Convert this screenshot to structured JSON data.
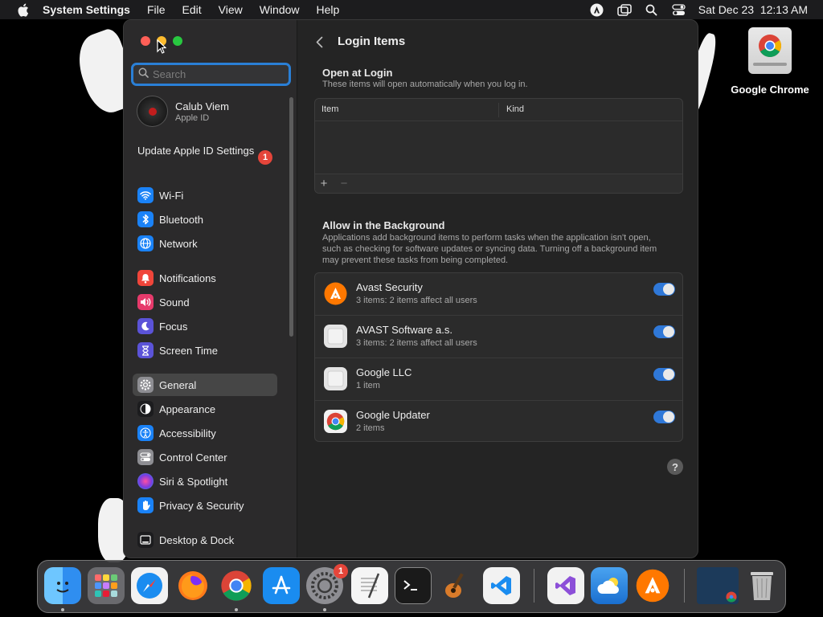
{
  "menubar": {
    "app_name": "System Settings",
    "menus": [
      "File",
      "Edit",
      "View",
      "Window",
      "Help"
    ],
    "datetime": "Sat Dec 23  12:13 AM",
    "status_icons": [
      "avast-icon",
      "window-icon",
      "search-icon",
      "control-center-icon"
    ]
  },
  "desktop": {
    "icon_label": "Google Chrome"
  },
  "sidebar": {
    "search_placeholder": "Search",
    "account_name": "Calub Viem",
    "account_sub": "Apple ID",
    "update_label": "Update Apple ID Settings",
    "update_badge": "1",
    "items": [
      {
        "label": "Wi-Fi",
        "icon": "wifi-icon",
        "color": "#1a82f7"
      },
      {
        "label": "Bluetooth",
        "icon": "bluetooth-icon",
        "color": "#1a82f7"
      },
      {
        "label": "Network",
        "icon": "globe-icon",
        "color": "#1a82f7"
      },
      {
        "label": "Notifications",
        "icon": "bell-icon",
        "color": "#f0453a"
      },
      {
        "label": "Sound",
        "icon": "speaker-icon",
        "color": "#e63a6b"
      },
      {
        "label": "Focus",
        "icon": "moon-icon",
        "color": "#5b53d8"
      },
      {
        "label": "Screen Time",
        "icon": "hourglass-icon",
        "color": "#5b53d8"
      },
      {
        "label": "General",
        "icon": "gear-icon",
        "color": "#8e8e93"
      },
      {
        "label": "Appearance",
        "icon": "appearance-icon",
        "color": "#1c1c1e"
      },
      {
        "label": "Accessibility",
        "icon": "accessibility-icon",
        "color": "#1a82f7"
      },
      {
        "label": "Control Center",
        "icon": "control-center-icon",
        "color": "#8e8e93"
      },
      {
        "label": "Siri & Spotlight",
        "icon": "siri-icon",
        "color": "#b93ad8"
      },
      {
        "label": "Privacy & Security",
        "icon": "hand-icon",
        "color": "#1a82f7"
      },
      {
        "label": "Desktop & Dock",
        "icon": "dock-icon",
        "color": "#1c1c1e"
      }
    ],
    "active": "General"
  },
  "main": {
    "title": "Login Items",
    "open_at_login": {
      "title": "Open at Login",
      "description": "These items will open automatically when you log in.",
      "columns": [
        "Item",
        "Kind"
      ],
      "add": "+",
      "remove": "−"
    },
    "background": {
      "title": "Allow in the Background",
      "description": "Applications add background items to perform tasks when the application isn't open, such as checking for software updates or syncing data. Turning off a background item may prevent these tasks from being completed.",
      "items": [
        {
          "name": "Avast Security",
          "detail": "3 items: 2 items affect all users",
          "enabled": true,
          "icon": "avast-icon"
        },
        {
          "name": "AVAST Software a.s.",
          "detail": "3 items: 2 items affect all users",
          "enabled": true,
          "icon": "generic-app-icon"
        },
        {
          "name": "Google LLC",
          "detail": "1 item",
          "enabled": true,
          "icon": "generic-app-icon"
        },
        {
          "name": "Google Updater",
          "detail": "2 items",
          "enabled": true,
          "icon": "chrome-icon"
        }
      ]
    },
    "help": "?"
  },
  "dock": {
    "apps": [
      "Finder",
      "Launchpad",
      "Safari",
      "Firefox",
      "Google Chrome",
      "App Store",
      "System Settings",
      "TextEdit",
      "Terminal",
      "GarageBand",
      "Visual Studio Code",
      "Visual Studio",
      "Weather",
      "Avast",
      "Screenshot",
      "Trash"
    ],
    "system_settings_badge": "1"
  }
}
